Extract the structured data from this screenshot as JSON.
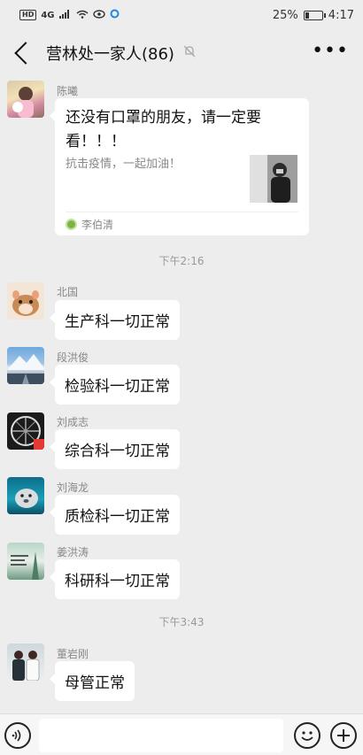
{
  "status_bar": {
    "network": "4G",
    "hd": "HD",
    "battery_text": "25%",
    "battery_level": 0.25,
    "time": "4:17"
  },
  "header": {
    "title": "营林处一家人(86)"
  },
  "messages": [
    {
      "sender": "陈曦",
      "type": "link_card",
      "card_title": "还没有口罩的朋友，请一定要看！！！",
      "card_desc": "抗击疫情，一起加油！",
      "card_source": "李伯清"
    },
    {
      "sender": "北国",
      "text": "生产科一切正常"
    },
    {
      "sender": "段洪俊",
      "text": "检验科一切正常"
    },
    {
      "sender": "刘成志",
      "text": "综合科一切正常"
    },
    {
      "sender": "刘海龙",
      "text": "质检科一切正常"
    },
    {
      "sender": "姜洪涛",
      "text": "科研科一切正常"
    },
    {
      "sender": "董岩刚",
      "text": "母管正常"
    }
  ],
  "timestamps": [
    "下午2:16",
    "下午3:43"
  ],
  "colors": {
    "background": "#ededed",
    "bubble": "#ffffff",
    "meta_text": "#888888"
  }
}
